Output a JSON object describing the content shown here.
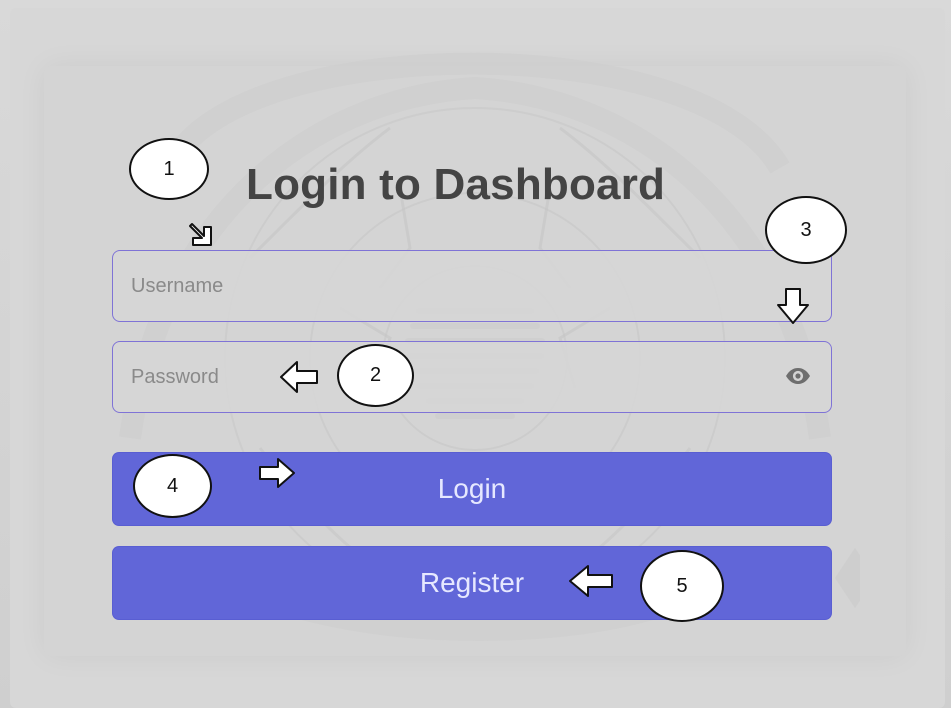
{
  "title": "Login to Dashboard",
  "form": {
    "username_placeholder": "Username",
    "password_placeholder": "Password",
    "login_label": "Login",
    "register_label": "Register"
  },
  "callouts": [
    {
      "label": "1"
    },
    {
      "label": "2"
    },
    {
      "label": "3"
    },
    {
      "label": "4"
    },
    {
      "label": "5"
    }
  ],
  "icons": {
    "password_visibility": "eye-icon",
    "callout_arrow": "arrow-icon"
  },
  "colors": {
    "background": "#d6d6d6",
    "field_border": "#7f73d6",
    "button_fill": "#6166d8",
    "button_text": "#e6e8ff",
    "title_text": "#444444",
    "placeholder_text": "#8a8a8a"
  }
}
